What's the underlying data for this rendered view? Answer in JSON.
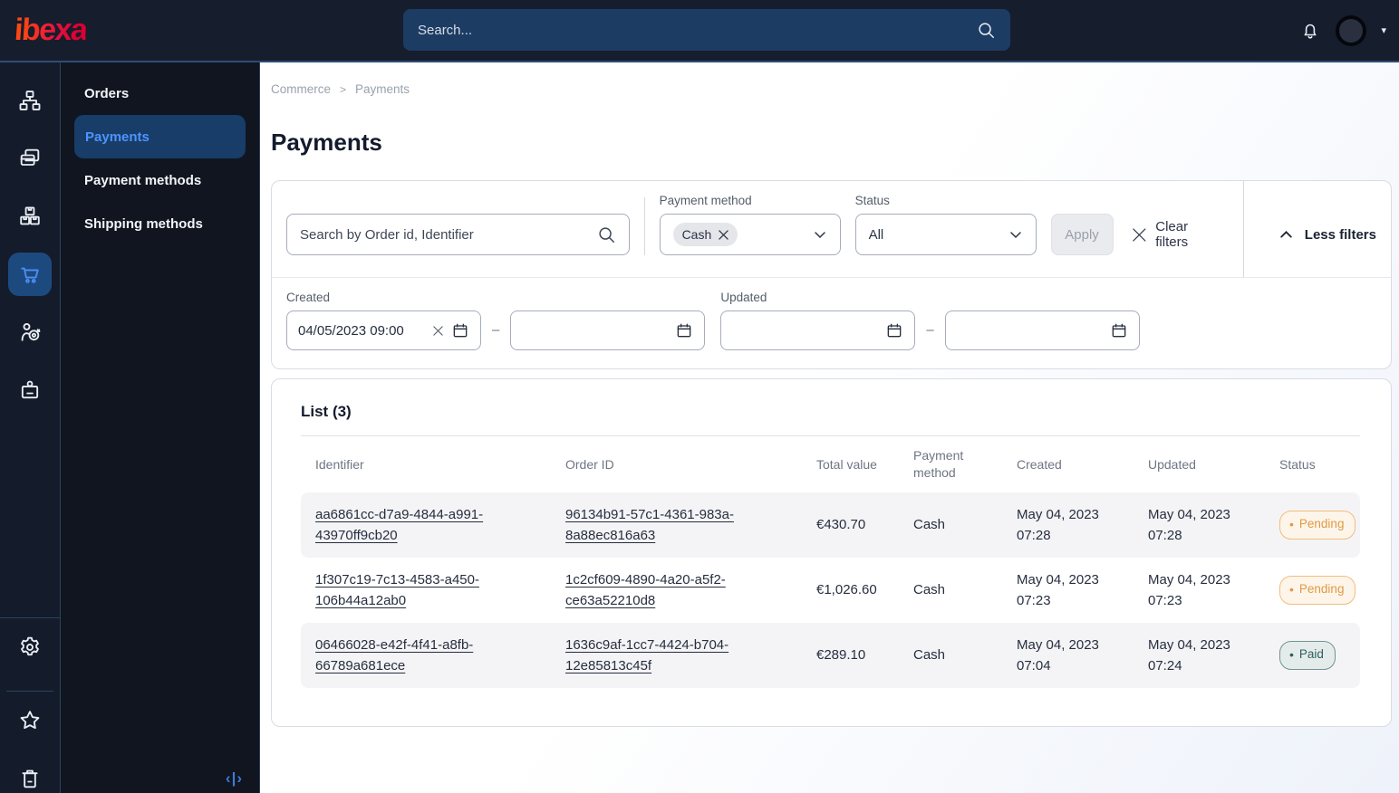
{
  "topbar": {
    "logo_text": "ibexa",
    "search_placeholder": "Search...",
    "icons": [
      "search-icon",
      "bell-icon",
      "avatar",
      "caret-down-icon"
    ]
  },
  "sidebar": {
    "rail_icons": [
      "content-structure-icon",
      "pages-icon",
      "products-icon",
      "commerce-cart-icon",
      "personalization-icon",
      "customers-icon",
      "settings-gear-icon",
      "bookmarks-star-icon",
      "trash-icon"
    ],
    "active_rail_icon": "commerce-cart-icon",
    "collapse_glyph": "‹|›"
  },
  "submenu": {
    "items": [
      {
        "label": "Orders",
        "active": false
      },
      {
        "label": "Payments",
        "active": true
      },
      {
        "label": "Payment methods",
        "active": false
      },
      {
        "label": "Shipping methods",
        "active": false
      }
    ]
  },
  "breadcrumb": {
    "parent": "Commerce",
    "separator": ">",
    "current": "Payments"
  },
  "page": {
    "title": "Payments"
  },
  "filters": {
    "search_placeholder": "Search by Order id, Identifier",
    "payment_method_label": "Payment method",
    "payment_method_chip": "Cash",
    "status_label": "Status",
    "status_value": "All",
    "apply_label": "Apply",
    "clear_label": "Clear filters",
    "less_label": "Less filters",
    "created_label": "Created",
    "created_from": "04/05/2023 09:00",
    "created_to": "",
    "updated_label": "Updated",
    "updated_from": "",
    "updated_to": ""
  },
  "list": {
    "title": "List (3)",
    "columns": [
      "Identifier",
      "Order ID",
      "Total value",
      "Payment method",
      "Created",
      "Updated",
      "Status"
    ],
    "rows": [
      {
        "identifier": "aa6861cc-d7a9-4844-a991-43970ff9cb20",
        "order_id": "96134b91-57c1-4361-983a-8a88ec816a63",
        "total": "€430.70",
        "method": "Cash",
        "created": "May 04, 2023 07:28",
        "updated": "May 04, 2023 07:28",
        "status": "Pending"
      },
      {
        "identifier": "1f307c19-7c13-4583-a450-106b44a12ab0",
        "order_id": "1c2cf609-4890-4a20-a5f2-ce63a52210d8",
        "total": "€1,026.60",
        "method": "Cash",
        "created": "May 04, 2023 07:23",
        "updated": "May 04, 2023 07:23",
        "status": "Pending"
      },
      {
        "identifier": "06466028-e42f-4f41-a8fb-66789a681ece",
        "order_id": "1636c9af-1cc7-4424-b704-12e85813c45f",
        "total": "€289.10",
        "method": "Cash",
        "created": "May 04, 2023 07:04",
        "updated": "May 04, 2023 07:24",
        "status": "Paid"
      }
    ]
  },
  "colors": {
    "topbar_bg": "#161d2d",
    "sidebar_bg": "#141b2a",
    "accent_blue": "#4e94ff",
    "active_tile_bg": "#1d4a7e",
    "logo_gradient_start": "#ff4713",
    "logo_gradient_end": "#db0032",
    "pending_badge": "#e09a44",
    "paid_badge": "#2f5f5e"
  }
}
